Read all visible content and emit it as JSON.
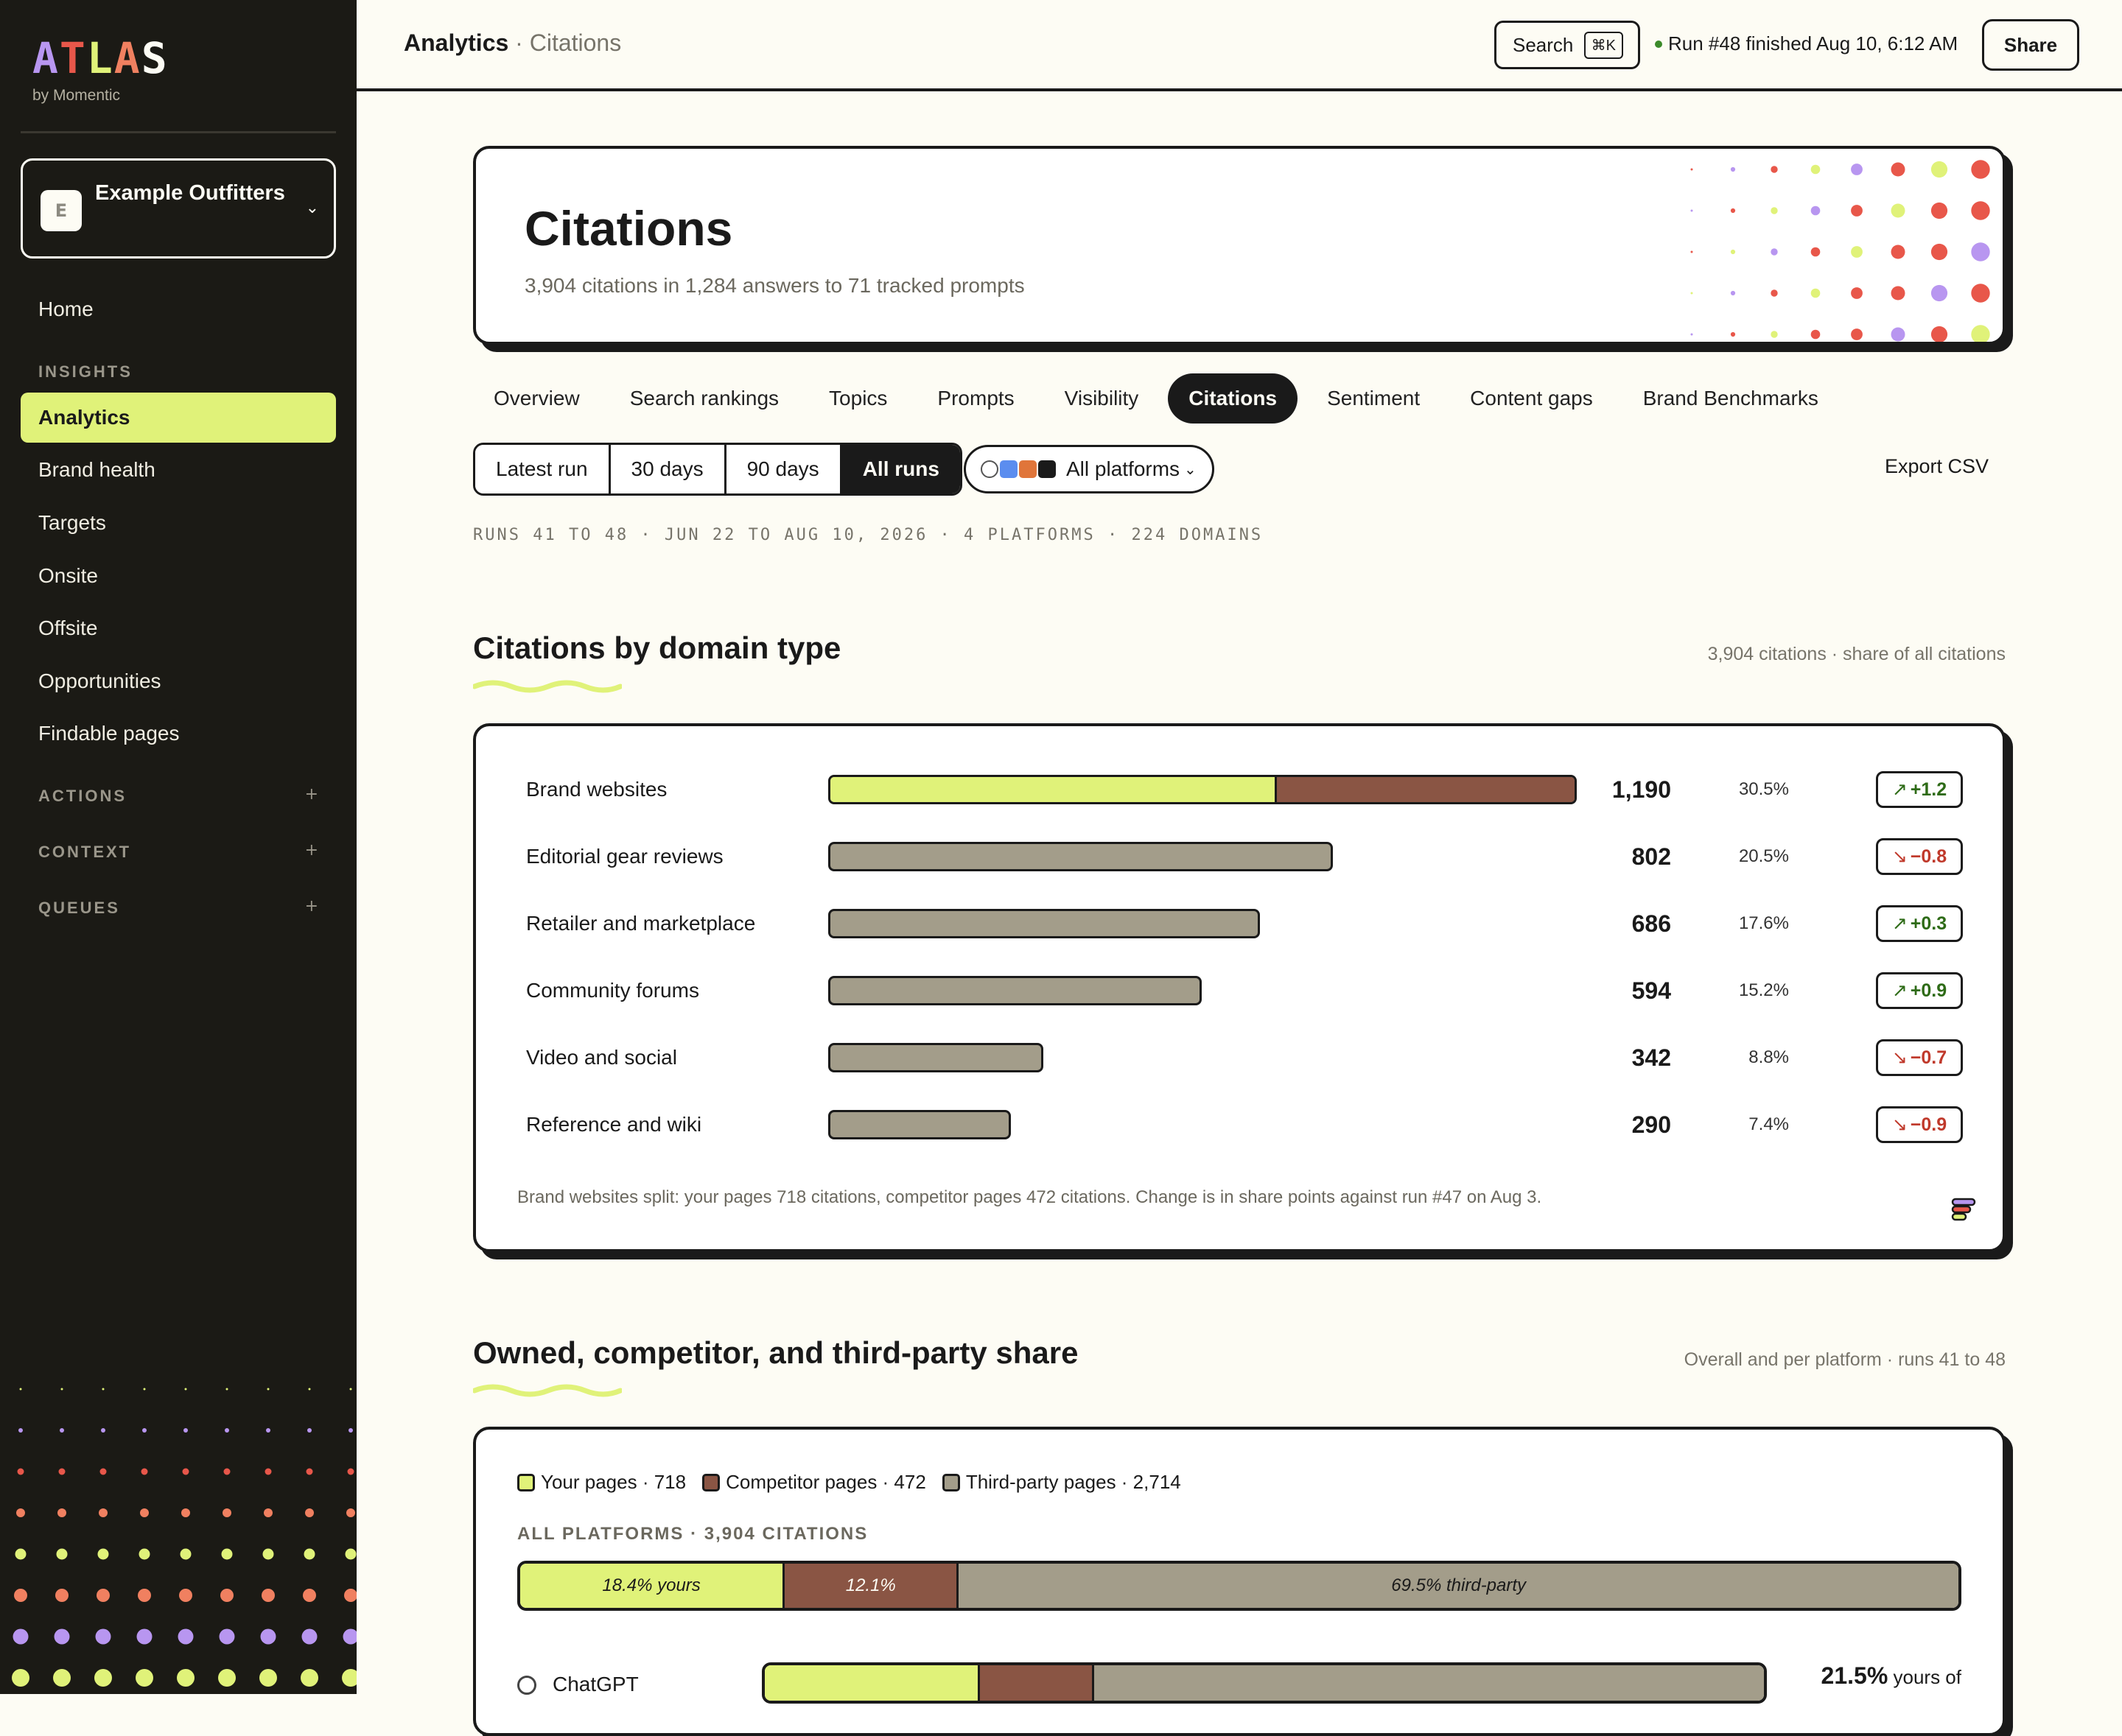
{
  "brand": {
    "logo_text": "ATLAS",
    "byline": "by Momentic"
  },
  "org": {
    "initial": "E",
    "name": "Example Outfitters"
  },
  "sidebar": {
    "home": "Home",
    "insights_heading": "INSIGHTS",
    "items": [
      "Analytics",
      "Brand health",
      "Targets",
      "Onsite",
      "Offsite",
      "Opportunities",
      "Findable pages"
    ],
    "actions": "ACTIONS",
    "context": "CONTEXT",
    "queues": "QUEUES"
  },
  "topbar": {
    "crumb_main": "Analytics",
    "crumb_sep": " · ",
    "crumb_sub": "Citations",
    "search_label": "Search",
    "search_kbd": "⌘K",
    "run_status": "Run #48 finished Aug 10, 6:12 AM",
    "share_label": "Share"
  },
  "hero": {
    "title": "Citations",
    "subtitle": "3,904 citations in 1,284 answers to 71 tracked prompts"
  },
  "tabs": [
    "Overview",
    "Search rankings",
    "Topics",
    "Prompts",
    "Visibility",
    "Citations",
    "Sentiment",
    "Content gaps",
    "Brand Benchmarks"
  ],
  "active_tab": "Citations",
  "ranges": [
    "Latest run",
    "30 days",
    "90 days",
    "All runs"
  ],
  "active_range": "All runs",
  "platform_filter": "All platforms",
  "export_label": "Export CSV",
  "meta_line": "RUNS 41 TO 48 · JUN 22 TO AUG 10, 2026 · 4 PLATFORMS · 224 DOMAINS",
  "domain_section": {
    "title": "Citations by domain type",
    "note": "3,904 citations · share of all citations",
    "rows": [
      {
        "label": "Brand websites",
        "value": "1,190",
        "share": "30.5%",
        "delta": "+1.2",
        "dir": "up",
        "fill": 1.0,
        "owned_frac": 0.6
      },
      {
        "label": "Editorial gear reviews",
        "value": "802",
        "share": "20.5%",
        "delta": "−0.8",
        "dir": "down",
        "fill": 0.674,
        "owned_frac": 0
      },
      {
        "label": "Retailer and marketplace",
        "value": "686",
        "share": "17.6%",
        "delta": "+0.3",
        "dir": "up",
        "fill": 0.577,
        "owned_frac": 0
      },
      {
        "label": "Community forums",
        "value": "594",
        "share": "15.2%",
        "delta": "+0.9",
        "dir": "up",
        "fill": 0.499,
        "owned_frac": 0
      },
      {
        "label": "Video and social",
        "value": "342",
        "share": "8.8%",
        "delta": "−0.7",
        "dir": "down",
        "fill": 0.287,
        "owned_frac": 0
      },
      {
        "label": "Reference and wiki",
        "value": "290",
        "share": "7.4%",
        "delta": "−0.9",
        "dir": "down",
        "fill": 0.244,
        "owned_frac": 0
      }
    ],
    "footnote": "Brand websites split: your pages 718 citations, competitor pages 472 citations. Change is in share points against run #47 on Aug 3."
  },
  "share_section": {
    "title": "Owned, competitor, and third-party share",
    "note": "Overall and per platform · runs 41 to 48",
    "legend": [
      "Your pages · 718",
      "Competitor pages · 472",
      "Third-party pages · 2,714"
    ],
    "colors": {
      "yours": "#e0f279",
      "competitor": "#8a5544",
      "third": "#a39d8a"
    },
    "all_label": "ALL PLATFORMS · 3,904 CITATIONS",
    "overall": {
      "yours": 18.4,
      "competitor": 12.1,
      "third": 69.5,
      "yours_label": "18.4% yours",
      "competitor_label": "12.1%",
      "third_label": "69.5% third-party"
    },
    "platforms": [
      {
        "name": "ChatGPT",
        "yours": 21.5,
        "competitor": 11.5,
        "third": 67.0,
        "share_pct": "21.5%",
        "share_suffix": "yours of"
      }
    ]
  }
}
